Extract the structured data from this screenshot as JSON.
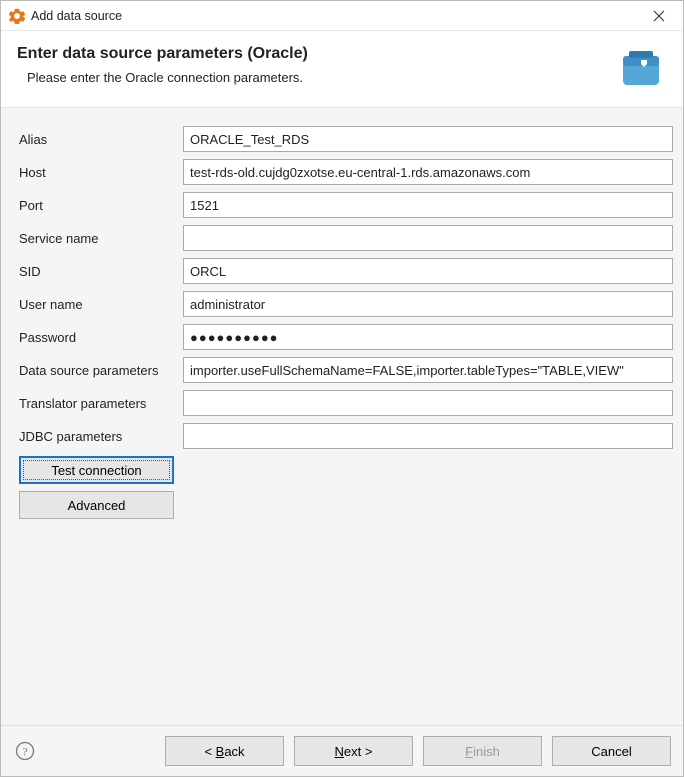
{
  "titlebar": {
    "title": "Add data source"
  },
  "header": {
    "title": "Enter data source parameters (Oracle)",
    "desc": "Please enter the Oracle connection parameters."
  },
  "form": {
    "alias_label": "Alias",
    "alias_value": "ORACLE_Test_RDS",
    "host_label": "Host",
    "host_value": "test-rds-old.cujdg0zxotse.eu-central-1.rds.amazonaws.com",
    "port_label": "Port",
    "port_value": "1521",
    "service_label": "Service name",
    "service_value": "",
    "sid_label": "SID",
    "sid_value": "ORCL",
    "username_label": "User name",
    "username_value": "administrator",
    "password_label": "Password",
    "password_value": "●●●●●●●●●●",
    "ds_params_label": "Data source parameters",
    "ds_params_value": "importer.useFullSchemaName=FALSE,importer.tableTypes=\"TABLE,VIEW\"",
    "translator_label": "Translator parameters",
    "translator_value": "",
    "jdbc_label": "JDBC parameters",
    "jdbc_value": "",
    "test_btn": "Test connection",
    "advanced_btn": "Advanced"
  },
  "buttons": {
    "back_pre": "< ",
    "back_m": "B",
    "back_post": "ack",
    "next_m": "N",
    "next_post": "ext >",
    "finish_m": "F",
    "finish_post": "inish",
    "cancel": "Cancel"
  }
}
